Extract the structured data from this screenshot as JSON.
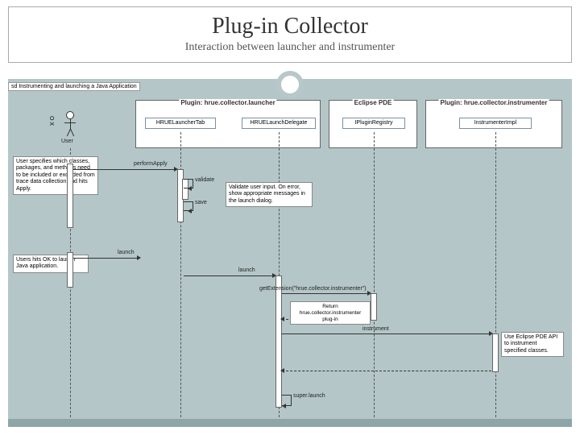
{
  "slide": {
    "title": "Plug-in Collector",
    "subtitle": "Interaction between launcher and instrumenter"
  },
  "diagram": {
    "caption": "sd Instrumenting and launching a Java Application",
    "actor": {
      "label": "User"
    },
    "packages": {
      "launcher": "Plugin: hrue.collector.launcher",
      "pde": "Eclipse PDE",
      "instrumenter": "Plugin: hrue.collector.instrumenter"
    },
    "lifelines": {
      "tab": "HRUELauncherTab",
      "delegate": "HRUELaunchDelegate",
      "registry": "IPluginRegistry",
      "instrimpl": "InstrumenterImpl"
    },
    "notes": {
      "spec": "User specifies which classes, packages, and methods need to be included or excluded from trace data collection and hits Apply.",
      "validate": "Validate user input. On error, show appropriate messages in the launch dialog.",
      "launchok": "Users hits OK to launch Java application.",
      "usepde": "Use Eclipse PDE API to instrument specified classes."
    },
    "messages": {
      "performApply": "performApply",
      "validate": "validate",
      "save": "save",
      "launch_user": "launch",
      "launch": "launch",
      "getExtension": "getExtension(\"hrue.collector.instrumenter\")",
      "returnPlugin": "Return hrue.collector.instrumenter plug-in",
      "instrument": "instrument",
      "superlaunch": "super.launch"
    }
  }
}
